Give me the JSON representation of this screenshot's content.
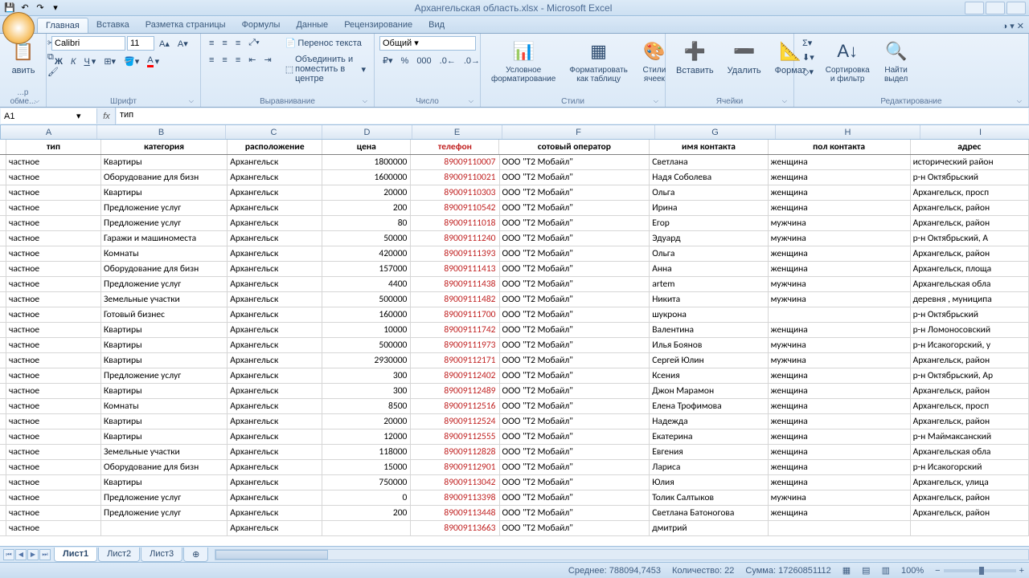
{
  "app": {
    "title": "Архангельская область.xlsx - Microsoft Excel"
  },
  "tabs": [
    "Главная",
    "Вставка",
    "Разметка страницы",
    "Формулы",
    "Данные",
    "Рецензирование",
    "Вид"
  ],
  "active_tab": 0,
  "ribbon": {
    "clipboard": {
      "label": "...р обме...",
      "paste": "авить"
    },
    "font": {
      "label": "Шрифт",
      "name": "Calibri",
      "size": "11"
    },
    "alignment": {
      "label": "Выравнивание",
      "wrap": "Перенос текста",
      "merge": "Объединить и поместить в центре"
    },
    "number": {
      "label": "Число",
      "format": "Общий"
    },
    "styles": {
      "label": "Стили",
      "cond": "Условное\nформатирование",
      "table": "Форматировать\nкак таблицу",
      "cell": "Стили\nячеек"
    },
    "cells": {
      "label": "Ячейки",
      "insert": "Вставить",
      "delete": "Удалить",
      "format": "Формат"
    },
    "editing": {
      "label": "Редактирование",
      "sort": "Сортировка\nи фильтр",
      "find": "Найти\nвыдел"
    }
  },
  "formula": {
    "cell": "A1",
    "fx": "fx",
    "value": "тип"
  },
  "colheads": [
    "A",
    "B",
    "C",
    "D",
    "E",
    "F",
    "G",
    "H",
    "I"
  ],
  "headers": [
    "тип",
    "категория",
    "расположение",
    "цена",
    "телефон",
    "сотовый оператор",
    "имя контакта",
    "пол контакта",
    "адрес"
  ],
  "rows": [
    {
      "a": "частное",
      "b": "Квартиры",
      "c": "Архангельск",
      "d": "1800000",
      "e": "89009110007",
      "f": "ООО \"Т2 Мобайл\"",
      "g": "Светлана",
      "h": "женщина",
      "i": "исторический район"
    },
    {
      "a": "частное",
      "b": "Оборудование для бизн",
      "c": "Архангельск",
      "d": "1600000",
      "e": "89009110021",
      "f": "ООО \"Т2 Мобайл\"",
      "g": "Надя Соболева",
      "h": "женщина",
      "i": "р-н Октябрьский"
    },
    {
      "a": "частное",
      "b": "Квартиры",
      "c": "Архангельск",
      "d": "20000",
      "e": "89009110303",
      "f": "ООО \"Т2 Мобайл\"",
      "g": "Ольга",
      "h": "женщина",
      "i": "Архангельск, просп"
    },
    {
      "a": "частное",
      "b": "Предложение услуг",
      "c": "Архангельск",
      "d": "200",
      "e": "89009110542",
      "f": "ООО \"Т2 Мобайл\"",
      "g": "Ирина",
      "h": "женщина",
      "i": "Архангельск, район"
    },
    {
      "a": "частное",
      "b": "Предложение услуг",
      "c": "Архангельск",
      "d": "80",
      "e": "89009111018",
      "f": "ООО \"Т2 Мобайл\"",
      "g": "Егор",
      "h": "мужчина",
      "i": "Архангельск, район"
    },
    {
      "a": "частное",
      "b": "Гаражи и машиноместа",
      "c": "Архангельск",
      "d": "50000",
      "e": "89009111240",
      "f": "ООО \"Т2 Мобайл\"",
      "g": "Эдуард",
      "h": "мужчина",
      "i": "р-н Октябрьский, А"
    },
    {
      "a": "частное",
      "b": "Комнаты",
      "c": "Архангельск",
      "d": "420000",
      "e": "89009111393",
      "f": "ООО \"Т2 Мобайл\"",
      "g": "Ольга",
      "h": "женщина",
      "i": "Архангельск, район"
    },
    {
      "a": "частное",
      "b": "Оборудование для бизн",
      "c": "Архангельск",
      "d": "157000",
      "e": "89009111413",
      "f": "ООО \"Т2 Мобайл\"",
      "g": "Анна",
      "h": "женщина",
      "i": "Архангельск, площа"
    },
    {
      "a": "частное",
      "b": "Предложение услуг",
      "c": "Архангельск",
      "d": "4400",
      "e": "89009111438",
      "f": "ООО \"Т2 Мобайл\"",
      "g": "artem",
      "h": "мужчина",
      "i": "Архангельская обла"
    },
    {
      "a": "частное",
      "b": "Земельные участки",
      "c": "Архангельск",
      "d": "500000",
      "e": "89009111482",
      "f": "ООО \"Т2 Мобайл\"",
      "g": "Никита",
      "h": "мужчина",
      "i": "деревня , муниципа"
    },
    {
      "a": "частное",
      "b": "Готовый бизнес",
      "c": "Архангельск",
      "d": "160000",
      "e": "89009111700",
      "f": "ООО \"Т2 Мобайл\"",
      "g": "шукрона",
      "h": "",
      "i": "р-н Октябрьский"
    },
    {
      "a": "частное",
      "b": "Квартиры",
      "c": "Архангельск",
      "d": "10000",
      "e": "89009111742",
      "f": "ООО \"Т2 Мобайл\"",
      "g": "Валентина",
      "h": "женщина",
      "i": "р-н Ломоносовский"
    },
    {
      "a": "частное",
      "b": "Квартиры",
      "c": "Архангельск",
      "d": "500000",
      "e": "89009111973",
      "f": "ООО \"Т2 Мобайл\"",
      "g": "Илья Боянов",
      "h": "мужчина",
      "i": "р-н Исакогорский, у"
    },
    {
      "a": "частное",
      "b": "Квартиры",
      "c": "Архангельск",
      "d": "2930000",
      "e": "89009112171",
      "f": "ООО \"Т2 Мобайл\"",
      "g": "Сергей Юлин",
      "h": "мужчина",
      "i": "Архангельск, район"
    },
    {
      "a": "частное",
      "b": "Предложение услуг",
      "c": "Архангельск",
      "d": "300",
      "e": "89009112402",
      "f": "ООО \"Т2 Мобайл\"",
      "g": "Ксения",
      "h": "женщина",
      "i": "р-н Октябрьский, Ар"
    },
    {
      "a": "частное",
      "b": "Квартиры",
      "c": "Архангельск",
      "d": "300",
      "e": "89009112489",
      "f": "ООО \"Т2 Мобайл\"",
      "g": "Джон Марамон",
      "h": "женщина",
      "i": "Архангельск, район"
    },
    {
      "a": "частное",
      "b": "Комнаты",
      "c": "Архангельск",
      "d": "8500",
      "e": "89009112516",
      "f": "ООО \"Т2 Мобайл\"",
      "g": "Елена Трофимова",
      "h": "женщина",
      "i": "Архангельск, просп"
    },
    {
      "a": "частное",
      "b": "Квартиры",
      "c": "Архангельск",
      "d": "20000",
      "e": "89009112524",
      "f": "ООО \"Т2 Мобайл\"",
      "g": "Надежда",
      "h": "женщина",
      "i": "Архангельск, район"
    },
    {
      "a": "частное",
      "b": "Квартиры",
      "c": "Архангельск",
      "d": "12000",
      "e": "89009112555",
      "f": "ООО \"Т2 Мобайл\"",
      "g": "Екатерина",
      "h": "женщина",
      "i": "р-н Маймаксанский"
    },
    {
      "a": "частное",
      "b": "Земельные участки",
      "c": "Архангельск",
      "d": "118000",
      "e": "89009112828",
      "f": "ООО \"Т2 Мобайл\"",
      "g": "Евгения",
      "h": "женщина",
      "i": "Архангельская обла"
    },
    {
      "a": "частное",
      "b": "Оборудование для бизн",
      "c": "Архангельск",
      "d": "15000",
      "e": "89009112901",
      "f": "ООО \"Т2 Мобайл\"",
      "g": "Лариса",
      "h": "женщина",
      "i": "р-н Исакогорский"
    },
    {
      "a": "частное",
      "b": "Квартиры",
      "c": "Архангельск",
      "d": "750000",
      "e": "89009113042",
      "f": "ООО \"Т2 Мобайл\"",
      "g": "Юлия",
      "h": "женщина",
      "i": "Архангельск, улица"
    },
    {
      "a": "частное",
      "b": "Предложение услуг",
      "c": "Архангельск",
      "d": "0",
      "e": "89009113398",
      "f": "ООО \"Т2 Мобайл\"",
      "g": "Толик Салтыков",
      "h": "мужчина",
      "i": "Архангельск, район"
    },
    {
      "a": "частное",
      "b": "Предложение услуг",
      "c": "Архангельск",
      "d": "200",
      "e": "89009113448",
      "f": "ООО \"Т2 Мобайл\"",
      "g": "Светлана Батоногова",
      "h": "женщина",
      "i": "Архангельск, район"
    },
    {
      "a": "частное",
      "b": "",
      "c": "Архангельск",
      "d": "",
      "e": "89009113663",
      "f": "ООО \"Т2 Мобайл\"",
      "g": "дмитрий",
      "h": "",
      "i": ""
    }
  ],
  "sheets": [
    "Лист1",
    "Лист2",
    "Лист3"
  ],
  "active_sheet": 0,
  "status": {
    "avg_label": "Среднее:",
    "avg": "788094,7453",
    "count_label": "Количество:",
    "count": "22",
    "sum_label": "Сумма:",
    "sum": "17260851112",
    "zoom": "100%"
  }
}
